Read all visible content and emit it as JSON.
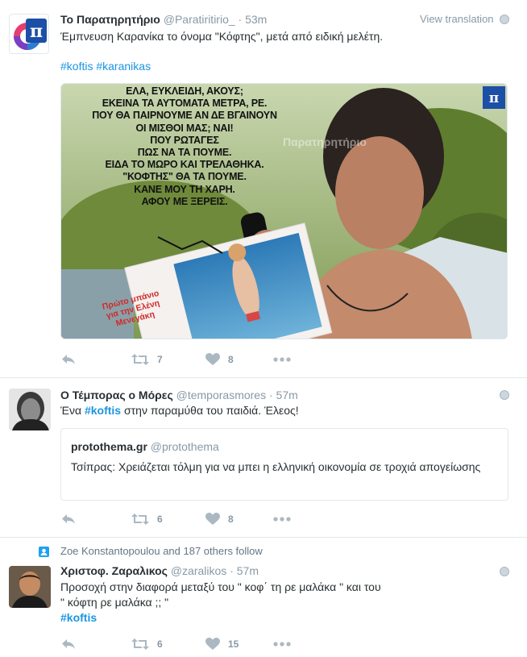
{
  "tweets": [
    {
      "fullname": "Το Παρατηρητήριο",
      "handle": "@Paratiritirio_",
      "dot": "·",
      "time": "53m",
      "view_translation": "View translation",
      "text": "Έμπνευση Καρανίκα το όνομα \"Κόφτης\", μετά από ειδική μελέτη.",
      "hashtags": [
        "#koftis",
        "#karanikas"
      ],
      "media": {
        "meme_lines": [
          "ΕΛΑ, ΕΥΚΛΕΙΔΗ, ΑΚΟΥΣ;",
          "ΕΚΕΙΝΑ ΤΑ ΑΥΤΟΜΑΤΑ ΜΕΤΡΑ, ΡΕ.",
          "ΠΟΥ ΘΑ ΠΑΙΡΝΟΥΜΕ ΑΝ ΔΕ ΒΓΑΙΝΟΥΝ",
          "ΟΙ ΜΙΣΘΟΙ ΜΑΣ; ΝΑΙ!",
          "ΠΟΥ ΡΩΤΑΓΕΣ",
          "ΠΩΣ ΝΑ ΤΑ ΠΟΥΜΕ.",
          "ΕΙΔΑ ΤΟ ΜΩΡΟ ΚΑΙ ΤΡΕΛΑΘΗΚΑ.",
          "\"ΚΟΦΤΗΣ\" ΘΑ ΤΑ ΠΟΥΜΕ.",
          "ΚΑΝΕ ΜΟΥ ΤΗ ΧΑΡΗ.",
          "ΑΦΟΥ ΜΕ ΞΕΡΕΙΣ."
        ],
        "watermark": "Παρατηρητήριο",
        "card_text": [
          "Πρώτο μπάνιο",
          "για την Ελένη",
          "Μενεγάκη"
        ]
      },
      "retweets": "7",
      "likes": "8"
    },
    {
      "fullname": "Ο Τέμπορας ο Μόρες",
      "handle": "@temporasmores",
      "dot": "·",
      "time": "57m",
      "text_before": "Ένα ",
      "hashtag": "#koftis",
      "text_after": " στην παραμύθα του παιδιά. Έλεος!",
      "quote": {
        "name": "protothema.gr",
        "handle": "@protothema",
        "text": "Τσίπρας: Χρειάζεται τόλμη για να μπει η ελληνική οικονομία σε τροχιά απογείωσης"
      },
      "retweets": "6",
      "likes": "8"
    },
    {
      "context": "Zoe Konstantopoulou and 187 others follow",
      "fullname": "Χριστοφ. Ζαραλικος",
      "handle": "@zaralikos",
      "dot": "·",
      "time": "57m",
      "text_line1": "Προσοχή στην διαφορά μεταξύ του \" κοφ΄ τη ρε μαλάκα \" και του",
      "text_line2": "\" κόφτη ρε μαλάκα ;; \"",
      "hashtag": "#koftis",
      "retweets": "6",
      "likes": "15"
    }
  ],
  "colors": {
    "link": "#1b95e0",
    "muted": "#8899a6",
    "text": "#292f33",
    "border": "#e1e8ed"
  }
}
